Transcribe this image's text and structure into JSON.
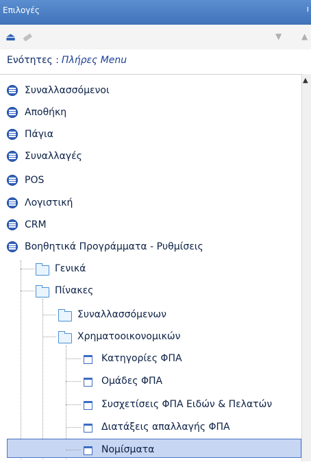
{
  "window": {
    "title": "Επιλογές"
  },
  "sections": {
    "label": "Ενότητες :",
    "value": "Πλήρες Menu"
  },
  "tree": {
    "top": [
      "Συναλλασσόμενοι",
      "Αποθήκη",
      "Πάγια",
      "Συναλλαγές",
      "POS",
      "Λογιστική",
      "CRM",
      "Βοηθητικά Προγράμματα - Ρυθμίσεις"
    ],
    "level1": [
      "Γενικά",
      "Πίνακες"
    ],
    "level2": [
      "Συναλλασσόμενων",
      "Χρηματοοικονομικών"
    ],
    "level3": [
      "Κατηγορίες ΦΠΑ",
      "Ομάδες ΦΠΑ",
      "Συσχετίσεις ΦΠΑ Ειδών & Πελατών",
      "Διατάξεις απαλλαγής ΦΠΑ",
      "Νομίσματα"
    ]
  }
}
